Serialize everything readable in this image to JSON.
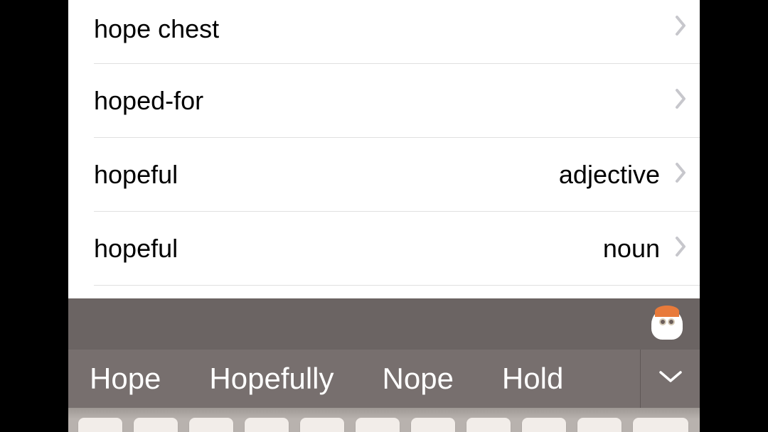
{
  "list": {
    "items": [
      {
        "word": "hope chest",
        "pos": ""
      },
      {
        "word": "hoped-for",
        "pos": ""
      },
      {
        "word": "hopeful",
        "pos": "adjective"
      },
      {
        "word": "hopeful",
        "pos": "noun"
      }
    ]
  },
  "suggestions": {
    "items": [
      {
        "text": "Hope"
      },
      {
        "text": "Hopefully"
      },
      {
        "text": "Nope"
      },
      {
        "text": "Hold"
      }
    ]
  }
}
